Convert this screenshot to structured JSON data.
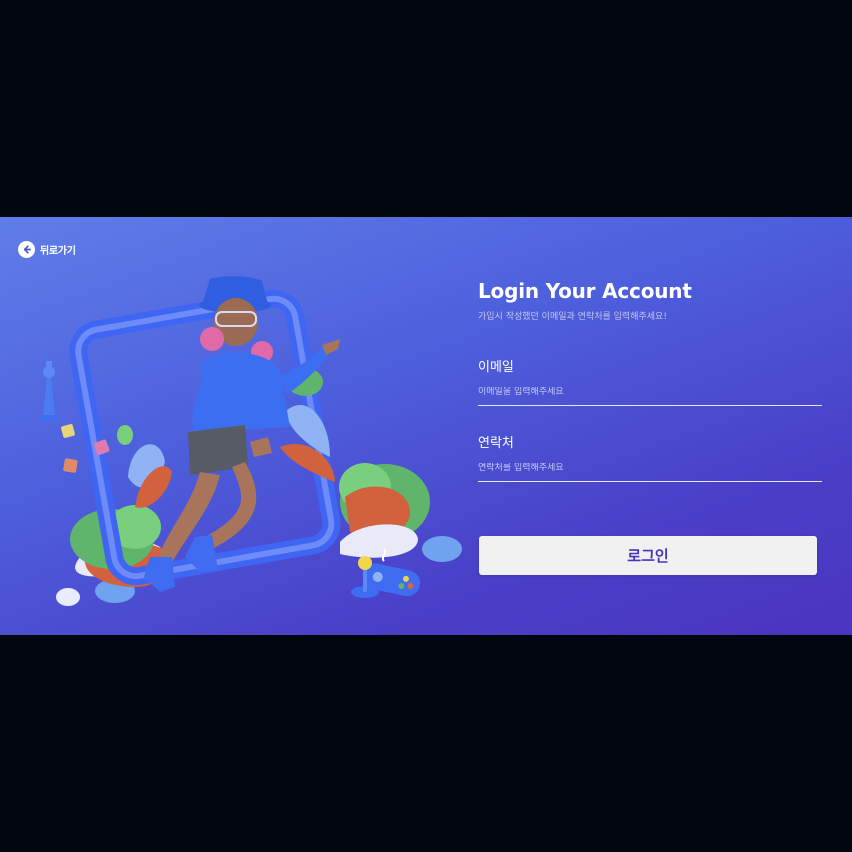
{
  "back": {
    "label": "뒤로가기"
  },
  "login": {
    "title": "Login Your Account",
    "subtitle": "가입시 작성했던 이메일과 연락처를 입력해주세요!",
    "email": {
      "label": "이메일",
      "placeholder": "이메일을 입력해주세요",
      "value": ""
    },
    "phone": {
      "label": "연락처",
      "placeholder": "연락처를 입력해주세요",
      "value": ""
    },
    "submit_label": "로그인"
  },
  "colors": {
    "page_background": "#02070d",
    "panel_gradient_start": "#5f7de8",
    "panel_gradient_end": "#4a35bf",
    "button_background": "#f1f1f1",
    "button_text": "#4b33b8"
  },
  "icons": {
    "back": "arrow-left-icon",
    "illustration": "character-with-frame-illustration"
  }
}
